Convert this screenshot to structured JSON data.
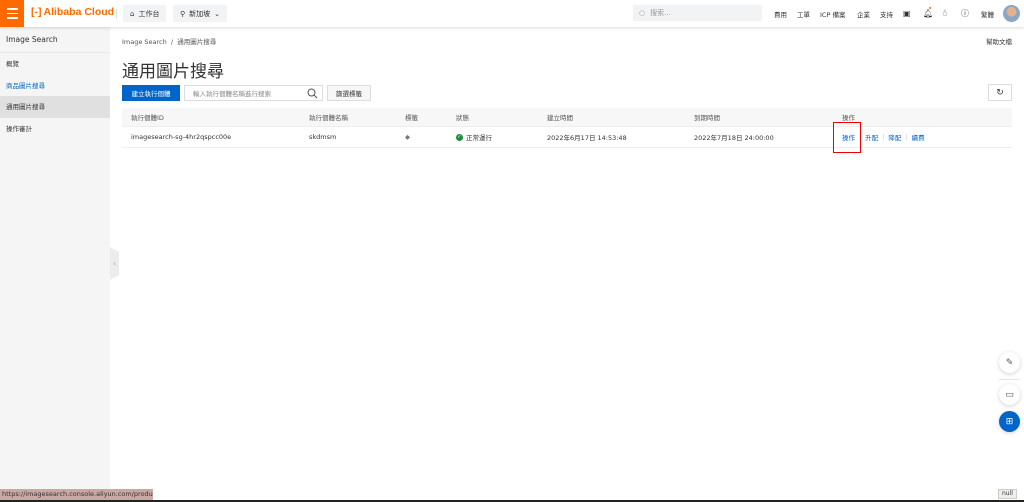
{
  "header": {
    "brand": "Alibaba Cloud",
    "workbench": "工作台",
    "region": "新加坡",
    "search_placeholder": "搜索...",
    "nav": [
      "費用",
      "工單",
      "ICP 備案",
      "企業",
      "支持"
    ],
    "lang": "繁體",
    "accent": "#ff6a00"
  },
  "sidebar": {
    "title": "Image Search",
    "items": [
      {
        "label": "概覽"
      },
      {
        "label": "商品圖片搜尋"
      },
      {
        "label": "通用圖片搜尋",
        "active": true
      },
      {
        "label": "操作審計"
      }
    ]
  },
  "breadcrumb": [
    "Image Search",
    "/",
    "通用圖片搜尋"
  ],
  "help_doc": "幫助文檔",
  "page_title": "通用圖片搜尋",
  "toolbar": {
    "create_label": "建立執行個體",
    "search_placeholder": "輸入執行個體名稱進行搜索",
    "tag_filter_label": "篩選標籤"
  },
  "table": {
    "columns": [
      "執行個體ID",
      "執行個體名稱",
      "標籤",
      "狀態",
      "建立時間",
      "到期時間",
      "操作"
    ],
    "rows": [
      {
        "id": "imagesearch-sg-4hr2qspcc00e",
        "name": "skdmsm",
        "status": "正常運行",
        "created": "2022年6月17日 14:53:48",
        "expires": "2022年7月18日 24:00:00",
        "actions": [
          "操作",
          "升配",
          "降配",
          "續費"
        ]
      }
    ]
  },
  "status_url": "https://imagesearch.console.aliyun.com/product-se",
  "null_badge": "null",
  "primary_color": "#0064c8"
}
